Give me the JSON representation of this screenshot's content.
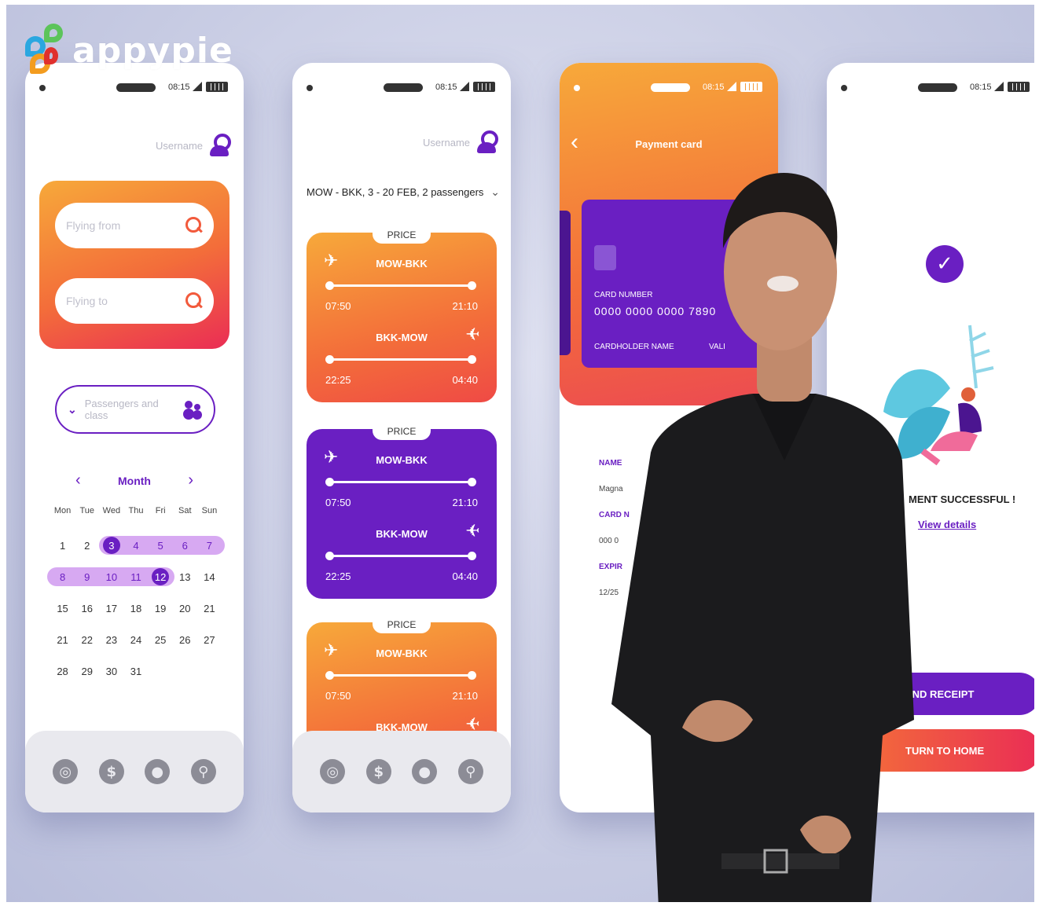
{
  "brand": {
    "logo_text": "appypie"
  },
  "status": {
    "time": "08:15"
  },
  "phone1": {
    "username": "Username",
    "flying_from_placeholder": "Flying from",
    "flying_to_placeholder": "Flying to",
    "passengers_label": "Passengers and class",
    "month_label": "Month",
    "weekdays": [
      "Mon",
      "Tue",
      "Wed",
      "Thu",
      "Fri",
      "Sat",
      "Sun"
    ],
    "weeks": [
      [
        "1",
        "2",
        "3",
        "4",
        "5",
        "6",
        "7"
      ],
      [
        "8",
        "9",
        "10",
        "11",
        "12",
        "13",
        "14"
      ],
      [
        "15",
        "16",
        "17",
        "18",
        "19",
        "20",
        "21"
      ],
      [
        "21",
        "22",
        "23",
        "24",
        "25",
        "26",
        "27"
      ],
      [
        "28",
        "29",
        "30",
        "31",
        "",
        "",
        ""
      ]
    ],
    "nav_icons": [
      "globe-icon",
      "dollar-icon",
      "location-icon",
      "search-icon"
    ]
  },
  "phone2": {
    "username": "Username",
    "route_summary": "MOW - BKK, 3 - 20 FEB, 2 passengers",
    "tickets": [
      {
        "price_label": "PRICE",
        "out_code": "MOW-BKK",
        "out_dep": "07:50",
        "out_arr": "21:10",
        "ret_code": "BKK-MOW",
        "ret_dep": "22:25",
        "ret_arr": "04:40",
        "style": "orange"
      },
      {
        "price_label": "PRICE",
        "out_code": "MOW-BKK",
        "out_dep": "07:50",
        "out_arr": "21:10",
        "ret_code": "BKK-MOW",
        "ret_dep": "22:25",
        "ret_arr": "04:40",
        "style": "purple"
      },
      {
        "price_label": "PRICE",
        "out_code": "MOW-BKK",
        "out_dep": "07:50",
        "out_arr": "21:10",
        "ret_code": "BKK-MOW",
        "style": "orange"
      }
    ]
  },
  "phone3": {
    "title": "Payment card",
    "card_number_label": "CARD NUMBER",
    "card_number": "0000 0000 0000 7890",
    "cardholder_label": "CARDHOLDER NAME",
    "valid_label": "VALI",
    "fields": [
      {
        "key": "NAME",
        "value": "Magna"
      },
      {
        "key": "CARD N",
        "value": "000 0"
      },
      {
        "key": "EXPIR",
        "value": "12/25"
      }
    ]
  },
  "phone4": {
    "success_text": "MENT SUCCESSFUL !",
    "view_details": "View details",
    "send_receipt": "END RECEIPT",
    "return_home": "TURN TO HOME"
  },
  "colors": {
    "purple": "#6a1fc2",
    "orange": "#f7a93a",
    "red": "#ea2d55"
  }
}
